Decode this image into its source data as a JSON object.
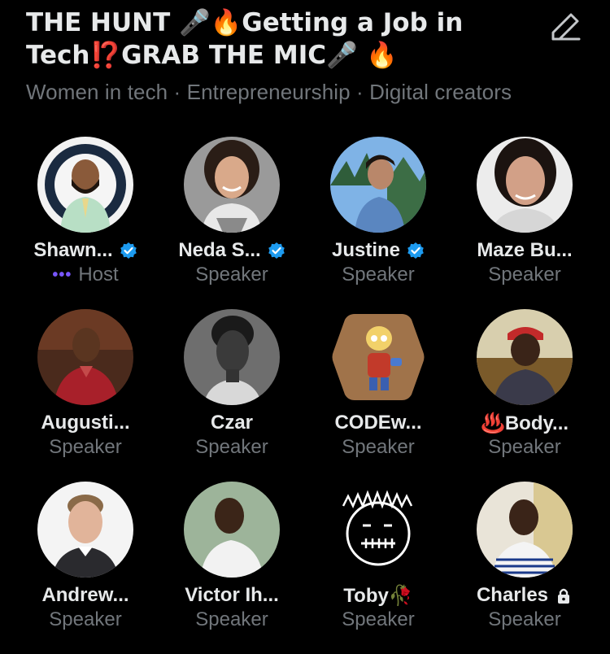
{
  "space": {
    "title": "THE HUNT 🎤🔥Getting a Job in Tech⁉️GRAB THE MIC🎤 🔥",
    "topics": "Women in tech · Entrepreneurship · Digital creators"
  },
  "participants": [
    {
      "name": "Shawn...",
      "role": "Host",
      "verified": true,
      "icon": "avatar-shawn"
    },
    {
      "name": "Neda S...",
      "role": "Speaker",
      "verified": true,
      "icon": "avatar-neda"
    },
    {
      "name": "Justine",
      "role": "Speaker",
      "verified": true,
      "icon": "avatar-justine"
    },
    {
      "name": "Maze Bu...",
      "role": "Speaker",
      "verified": false,
      "icon": "avatar-maze"
    },
    {
      "name": "Augusti...",
      "role": "Speaker",
      "verified": false,
      "icon": "avatar-augustine"
    },
    {
      "name": "Czar",
      "role": "Speaker",
      "verified": false,
      "icon": "avatar-czar"
    },
    {
      "name": "CODEw...",
      "role": "Speaker",
      "verified": false,
      "icon": "avatar-codew"
    },
    {
      "name": "♨️Body...",
      "role": "Speaker",
      "verified": false,
      "icon": "avatar-body"
    },
    {
      "name": "Andrew...",
      "role": "Speaker",
      "verified": false,
      "icon": "avatar-andrew"
    },
    {
      "name": "Victor Ih...",
      "role": "Speaker",
      "verified": false,
      "icon": "avatar-victor"
    },
    {
      "name": "Toby🥀",
      "role": "Speaker",
      "verified": false,
      "icon": "avatar-toby"
    },
    {
      "name": "Charles",
      "role": "Speaker",
      "verified": false,
      "locked": true,
      "icon": "avatar-charles"
    }
  ],
  "colors": {
    "background": "#000000",
    "name_text": "#e7e9ea",
    "secondary_text": "#71767b",
    "verified_blue": "#1d9bf0",
    "host_dots": "#7856ff"
  }
}
